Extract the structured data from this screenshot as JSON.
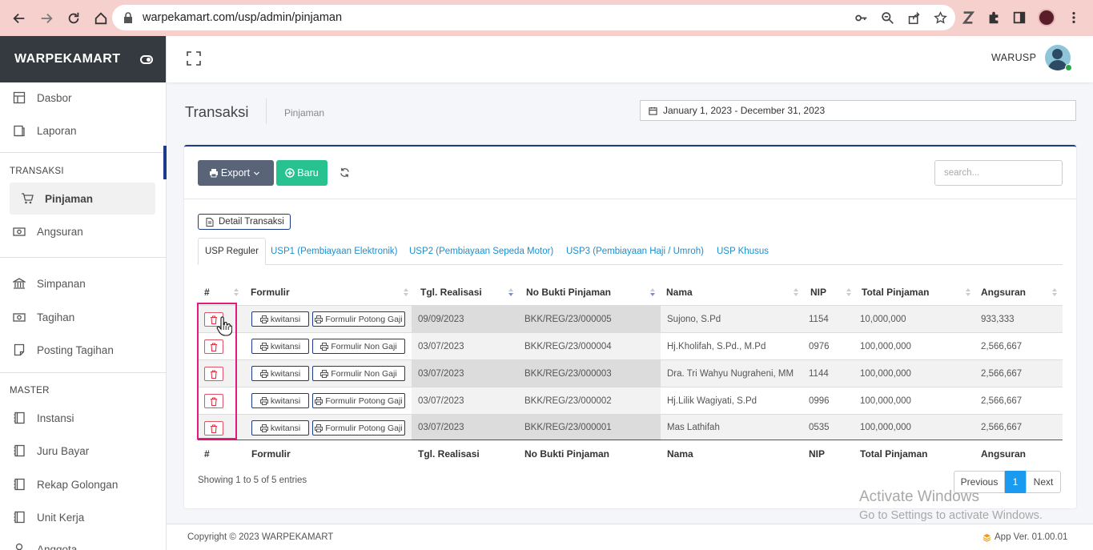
{
  "browser": {
    "url": "warpekamart.com/usp/admin/pinjaman"
  },
  "sidebar": {
    "brand": "WARPEKAMART",
    "items": [
      {
        "label": "Dasbor",
        "icon": "dashboard-icon"
      },
      {
        "label": "Laporan",
        "icon": "report-icon"
      },
      {
        "label": "Pinjaman",
        "icon": "cart-icon"
      },
      {
        "label": "Angsuran",
        "icon": "money-icon"
      },
      {
        "label": "Simpanan",
        "icon": "bank-icon"
      },
      {
        "label": "Tagihan",
        "icon": "money-icon"
      },
      {
        "label": "Posting Tagihan",
        "icon": "note-icon"
      },
      {
        "label": "Instansi",
        "icon": "book-icon"
      },
      {
        "label": "Juru Bayar",
        "icon": "book-icon"
      },
      {
        "label": "Rekap Golongan",
        "icon": "book-icon"
      },
      {
        "label": "Unit Kerja",
        "icon": "book-icon"
      },
      {
        "label": "Anggota",
        "icon": "user-icon"
      }
    ],
    "section_transaksi": "TRANSAKSI",
    "section_master": "MASTER"
  },
  "topnav": {
    "user": "WARUSP"
  },
  "page": {
    "title": "Transaksi",
    "breadcrumb": "Pinjaman",
    "date_range": "January 1, 2023 - December 31, 2023"
  },
  "toolbar": {
    "export_label": "Export",
    "baru_label": "Baru",
    "search_placeholder": "search..."
  },
  "detail_label": "Detail Transaksi",
  "tabs": [
    "USP Reguler",
    "USP1 (Pembiayaan Elektronik)",
    "USP2 (Pembiayaan Sepeda Motor)",
    "USP3 (Pembiayaan Haji / Umroh)",
    "USP Khusus"
  ],
  "table": {
    "headers": [
      "#",
      "Formulir",
      "Tgl. Realisasi",
      "No Bukti Pinjaman",
      "Nama",
      "NIP",
      "Total Pinjaman",
      "Angsuran"
    ],
    "kwitansi_label": "kwitansi",
    "rows": [
      {
        "formulir": "Formulir Potong Gaji",
        "tgl": "09/09/2023",
        "no_bukti": "BKK/REG/23/000005",
        "nama": "Sujono, S.Pd",
        "nip": "1154",
        "total": "10,000,000",
        "angsuran": "933,333"
      },
      {
        "formulir": "Formulir Non Gaji",
        "tgl": "03/07/2023",
        "no_bukti": "BKK/REG/23/000004",
        "nama": "Hj.Kholifah, S.Pd., M.Pd",
        "nip": "0976",
        "total": "100,000,000",
        "angsuran": "2,566,667"
      },
      {
        "formulir": "Formulir Non Gaji",
        "tgl": "03/07/2023",
        "no_bukti": "BKK/REG/23/000003",
        "nama": "Dra. Tri Wahyu Nugraheni, MM",
        "nip": "1144",
        "total": "100,000,000",
        "angsuran": "2,566,667"
      },
      {
        "formulir": "Formulir Potong Gaji",
        "tgl": "03/07/2023",
        "no_bukti": "BKK/REG/23/000002",
        "nama": "Hj.Lilik Wagiyati, S.Pd",
        "nip": "0996",
        "total": "100,000,000",
        "angsuran": "2,566,667"
      },
      {
        "formulir": "Formulir Potong Gaji",
        "tgl": "03/07/2023",
        "no_bukti": "BKK/REG/23/000001",
        "nama": "Mas Lathifah",
        "nip": "0535",
        "total": "100,000,000",
        "angsuran": "2,566,667"
      }
    ],
    "showing": "Showing 1 to 5 of 5 entries"
  },
  "pagination": {
    "previous": "Previous",
    "current": "1",
    "next": "Next"
  },
  "watermark": {
    "line1": "Activate Windows",
    "line2": "Go to Settings to activate Windows."
  },
  "footer": {
    "copyright": "Copyright © 2023 WARPEKAMART",
    "version": "App Ver. 01.00.01"
  }
}
